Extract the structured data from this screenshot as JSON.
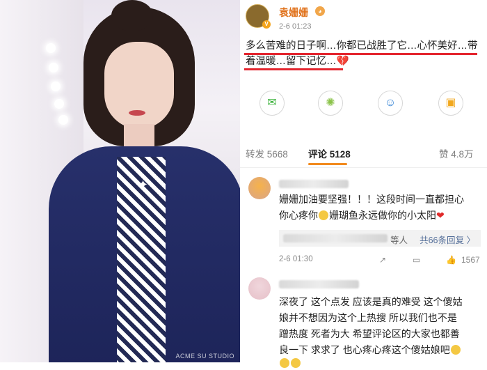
{
  "post": {
    "username": "袁姗姗",
    "time": "2-6 01:23",
    "text_line1": "多么苦难的日子啊…你都已战胜了它…心怀美好…带",
    "text_line2": "着温暖…留下记忆…",
    "broken_heart": "💔"
  },
  "photo": {
    "watermark": "ACME SU STUDIO"
  },
  "share_icons": [
    "wechat-icon",
    "moments-icon",
    "qq-icon",
    "qzone-icon"
  ],
  "tabs": {
    "repost": "转发 5668",
    "comment": "评论 5128",
    "like": "赞 4.8万"
  },
  "comment1": {
    "line1": "姗姗加油要坚强！！！这段时间一直都担心",
    "line2a": "你心疼你",
    "line2b": "姗瑚鱼永远做你的小太阳",
    "heart": "❤",
    "reply_who": "等人",
    "reply_more": "共66条回复 〉",
    "time": "2-6 01:30",
    "likes": "1567"
  },
  "comment2": {
    "line1": "深夜了 这个点发 应该是真的难受 这个傻姑",
    "line2": "娘并不想因为这个上热搜 所以我们也不是",
    "line3": "蹭热度 死者为大 希望评论区的大家也都善",
    "line4": "良一下 求求了 也心疼心疼这个傻姑娘吧"
  },
  "colors": {
    "username": "#e0711a",
    "underline": "#e4262f",
    "tab_accent": "#f28a1e",
    "link": "#56709a"
  }
}
